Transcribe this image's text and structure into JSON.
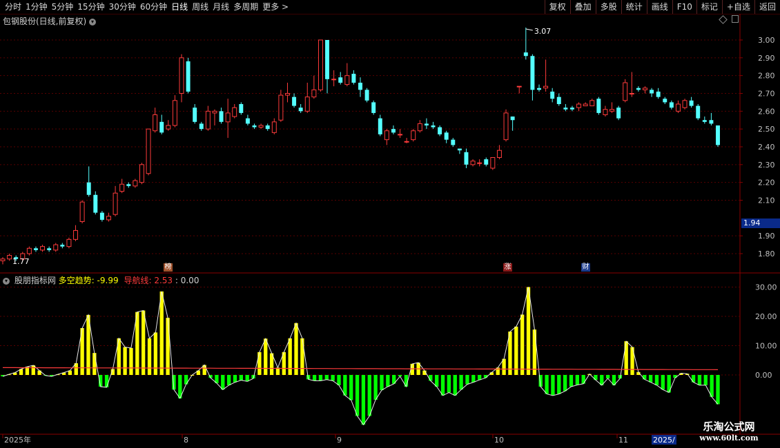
{
  "toolbar": {
    "periods": [
      "分时",
      "1分钟",
      "5分钟",
      "15分钟",
      "30分钟",
      "60分钟",
      "日线",
      "周线",
      "月线",
      "多周期",
      "更多"
    ],
    "active_period": "日线",
    "right_buttons": [
      "复权",
      "叠加",
      "多股",
      "统计",
      "画线",
      "F10",
      "标记",
      "+自选",
      "返回"
    ]
  },
  "main_panel": {
    "title": "包钢股份(日线,前复权)",
    "price_axis": [
      "3.00",
      "2.90",
      "2.80",
      "2.70",
      "2.60",
      "2.50",
      "2.40",
      "2.30",
      "2.20",
      "2.10",
      "1.90",
      "1.80"
    ],
    "current_price": "1.94",
    "high_label": "3.07",
    "low_label": "1.77",
    "markers": [
      {
        "text": "榜",
        "color": "#a0522d"
      },
      {
        "text": "涨",
        "color": "#8b1a1a"
      },
      {
        "text": "财",
        "color": "#1a3a8b"
      }
    ]
  },
  "indicator_panel": {
    "name": "股朋指标网",
    "label1": "多空趋势:",
    "value1": "-9.99",
    "label2": "导航线:",
    "value2": "2.53",
    "label3": ":",
    "value3": "0.00",
    "axis": [
      "30.00",
      "20.00",
      "10.00",
      "0.00"
    ]
  },
  "date_axis": {
    "labels": [
      "2025年",
      "8",
      "9",
      "10",
      "11"
    ],
    "current": "2025/"
  },
  "watermark": {
    "name": "乐淘公式网",
    "url": "www.60lt.com"
  },
  "colors": {
    "up": "#ff3b3b",
    "down": "#54ffff",
    "grid": "#5a0000",
    "yellow": "#ffff00",
    "green": "#00ff00"
  },
  "chart_data": {
    "type": "candlestick",
    "price_range": [
      1.74,
      3.1
    ],
    "candles": [
      [
        1.76,
        1.77,
        1.74,
        1.78
      ],
      [
        1.77,
        1.79,
        1.76,
        1.8
      ],
      [
        1.78,
        1.77,
        1.76,
        1.79
      ],
      [
        1.77,
        1.8,
        1.76,
        1.81
      ],
      [
        1.8,
        1.83,
        1.79,
        1.84
      ],
      [
        1.83,
        1.82,
        1.81,
        1.84
      ],
      [
        1.82,
        1.84,
        1.81,
        1.85
      ],
      [
        1.83,
        1.82,
        1.81,
        1.84
      ],
      [
        1.82,
        1.85,
        1.81,
        1.86
      ],
      [
        1.85,
        1.84,
        1.83,
        1.86
      ],
      [
        1.84,
        1.88,
        1.83,
        1.89
      ],
      [
        1.88,
        1.93,
        1.87,
        1.96
      ],
      [
        1.98,
        2.09,
        1.97,
        2.1
      ],
      [
        2.2,
        2.13,
        2.12,
        2.29
      ],
      [
        2.13,
        2.03,
        2.02,
        2.15
      ],
      [
        2.03,
        1.99,
        1.98,
        2.04
      ],
      [
        1.99,
        2.01,
        1.98,
        2.03
      ],
      [
        2.02,
        2.14,
        2.01,
        2.18
      ],
      [
        2.15,
        2.19,
        2.14,
        2.22
      ],
      [
        2.19,
        2.18,
        2.17,
        2.2
      ],
      [
        2.18,
        2.21,
        2.17,
        2.22
      ],
      [
        2.2,
        2.3,
        2.19,
        2.31
      ],
      [
        2.25,
        2.5,
        2.24,
        2.5
      ],
      [
        2.49,
        2.58,
        2.48,
        2.62
      ],
      [
        2.54,
        2.48,
        2.47,
        2.58
      ],
      [
        2.5,
        2.52,
        2.49,
        2.55
      ],
      [
        2.52,
        2.66,
        2.51,
        2.69
      ],
      [
        2.7,
        2.9,
        2.65,
        2.92
      ],
      [
        2.88,
        2.71,
        2.7,
        2.9
      ],
      [
        2.62,
        2.54,
        2.53,
        2.64
      ],
      [
        2.53,
        2.5,
        2.49,
        2.54
      ],
      [
        2.5,
        2.6,
        2.49,
        2.63
      ],
      [
        2.59,
        2.6,
        2.52,
        2.61
      ],
      [
        2.6,
        2.54,
        2.53,
        2.62
      ],
      [
        2.54,
        2.59,
        2.45,
        2.67
      ],
      [
        2.57,
        2.62,
        2.56,
        2.64
      ],
      [
        2.64,
        2.59,
        2.58,
        2.65
      ],
      [
        2.56,
        2.53,
        2.52,
        2.58
      ],
      [
        2.52,
        2.51,
        2.5,
        2.53
      ],
      [
        2.51,
        2.52,
        2.5,
        2.53
      ],
      [
        2.52,
        2.5,
        2.49,
        2.53
      ],
      [
        2.48,
        2.54,
        2.47,
        2.56
      ],
      [
        2.55,
        2.69,
        2.54,
        2.72
      ],
      [
        2.69,
        2.7,
        2.65,
        2.76
      ],
      [
        2.68,
        2.63,
        2.62,
        2.7
      ],
      [
        2.62,
        2.6,
        2.59,
        2.64
      ],
      [
        2.6,
        2.68,
        2.59,
        2.76
      ],
      [
        2.68,
        2.72,
        2.67,
        2.8
      ],
      [
        2.72,
        3.0,
        2.71,
        3.0
      ],
      [
        3.0,
        2.78,
        2.7,
        3.0
      ],
      [
        2.78,
        2.78,
        2.74,
        2.83
      ],
      [
        2.79,
        2.76,
        2.75,
        2.82
      ],
      [
        2.75,
        2.8,
        2.74,
        2.87
      ],
      [
        2.81,
        2.76,
        2.75,
        2.83
      ],
      [
        2.76,
        2.72,
        2.68,
        2.79
      ],
      [
        2.72,
        2.66,
        2.65,
        2.73
      ],
      [
        2.65,
        2.59,
        2.58,
        2.66
      ],
      [
        2.56,
        2.47,
        2.46,
        2.58
      ],
      [
        2.44,
        2.49,
        2.41,
        2.5
      ],
      [
        2.5,
        2.48,
        2.47,
        2.52
      ],
      [
        2.47,
        2.47,
        2.45,
        2.5
      ],
      [
        2.43,
        2.43,
        2.42,
        2.45
      ],
      [
        2.44,
        2.49,
        2.43,
        2.5
      ],
      [
        2.49,
        2.53,
        2.48,
        2.55
      ],
      [
        2.53,
        2.52,
        2.5,
        2.56
      ],
      [
        2.52,
        2.51,
        2.5,
        2.54
      ],
      [
        2.51,
        2.47,
        2.46,
        2.52
      ],
      [
        2.48,
        2.44,
        2.42,
        2.49
      ],
      [
        2.44,
        2.41,
        2.4,
        2.45
      ],
      [
        2.39,
        2.38,
        2.36,
        2.39
      ],
      [
        2.37,
        2.3,
        2.28,
        2.39
      ],
      [
        2.3,
        2.32,
        2.29,
        2.33
      ],
      [
        2.31,
        2.31,
        2.29,
        2.33
      ],
      [
        2.33,
        2.3,
        2.29,
        2.34
      ],
      [
        2.28,
        2.34,
        2.27,
        2.34
      ],
      [
        2.34,
        2.38,
        2.33,
        2.41
      ],
      [
        2.44,
        2.59,
        2.43,
        2.61
      ],
      [
        2.57,
        2.55,
        2.49,
        2.57
      ],
      [
        2.74,
        2.74,
        2.7,
        2.74
      ],
      [
        2.93,
        2.91,
        2.89,
        3.07
      ],
      [
        2.91,
        2.72,
        2.66,
        2.92
      ],
      [
        2.73,
        2.72,
        2.71,
        2.75
      ],
      [
        2.73,
        2.74,
        2.71,
        2.89
      ],
      [
        2.71,
        2.67,
        2.65,
        2.73
      ],
      [
        2.68,
        2.64,
        2.63,
        2.7
      ],
      [
        2.62,
        2.61,
        2.6,
        2.64
      ],
      [
        2.62,
        2.61,
        2.6,
        2.63
      ],
      [
        2.62,
        2.64,
        2.6,
        2.65
      ],
      [
        2.63,
        2.64,
        2.63,
        2.65
      ],
      [
        2.63,
        2.66,
        2.63,
        2.67
      ],
      [
        2.67,
        2.59,
        2.58,
        2.68
      ],
      [
        2.58,
        2.61,
        2.57,
        2.63
      ],
      [
        2.6,
        2.61,
        2.59,
        2.65
      ],
      [
        2.62,
        2.56,
        2.55,
        2.63
      ],
      [
        2.66,
        2.76,
        2.65,
        2.78
      ],
      [
        2.7,
        2.7,
        2.68,
        2.82
      ],
      [
        2.73,
        2.72,
        2.71,
        2.74
      ],
      [
        2.72,
        2.73,
        2.7,
        2.74
      ],
      [
        2.72,
        2.7,
        2.68,
        2.73
      ],
      [
        2.71,
        2.68,
        2.67,
        2.73
      ],
      [
        2.67,
        2.65,
        2.64,
        2.68
      ],
      [
        2.65,
        2.62,
        2.61,
        2.66
      ],
      [
        2.6,
        2.64,
        2.59,
        2.66
      ],
      [
        2.62,
        2.66,
        2.61,
        2.67
      ],
      [
        2.66,
        2.63,
        2.62,
        2.68
      ],
      [
        2.63,
        2.56,
        2.55,
        2.64
      ],
      [
        2.55,
        2.54,
        2.53,
        2.57
      ],
      [
        2.55,
        2.53,
        2.52,
        2.59
      ],
      [
        2.52,
        2.41,
        2.4,
        2.52
      ]
    ],
    "indicator": [
      -0.5,
      0.2,
      0.8,
      2,
      2.8,
      3.3,
      1.5,
      -0.2,
      -0.5,
      0.2,
      0.8,
      1.5,
      4,
      16,
      20.5,
      7.5,
      -4,
      -4.2,
      2,
      12.5,
      9.5,
      9.2,
      21.5,
      22,
      12.5,
      14.5,
      28.5,
      19.5,
      -5,
      -8,
      -3.2,
      0,
      1.5,
      3.4,
      -1,
      -2.8,
      -5,
      -3.5,
      -2.5,
      -1.8,
      -2.2,
      -1.2,
      7.8,
      12.4,
      7.4,
      2.5,
      7.8,
      12.5,
      17.7,
      12.5,
      -1.5,
      -2,
      -2,
      -1.6,
      -2,
      -3.5,
      -7,
      -8.6,
      -14,
      -17,
      -14,
      -8.5,
      -5.2,
      -4,
      -3,
      -0.5,
      -4,
      3.8,
      4.2,
      1.5,
      -2,
      -4,
      -7,
      -6,
      -7,
      -5,
      -3.2,
      -2.5,
      -1.7,
      -1,
      0.9,
      2.5,
      5.5,
      14.8,
      16.5,
      20.6,
      30,
      15.5,
      -4,
      -6.5,
      -7,
      -6.5,
      -5.5,
      -4,
      -3.4,
      -3,
      0.3,
      -1.7,
      -3.5,
      -1.2,
      -3.5,
      -1.2,
      11.5,
      9.5,
      1,
      -1.5,
      -2.5,
      -3.5,
      -5,
      -6,
      -1,
      0.6,
      0.4,
      -2.5,
      -3.5,
      -3.5,
      -7.5,
      -9.99
    ],
    "indicator_range": [
      -20,
      33
    ],
    "ma_value": 2.53
  }
}
